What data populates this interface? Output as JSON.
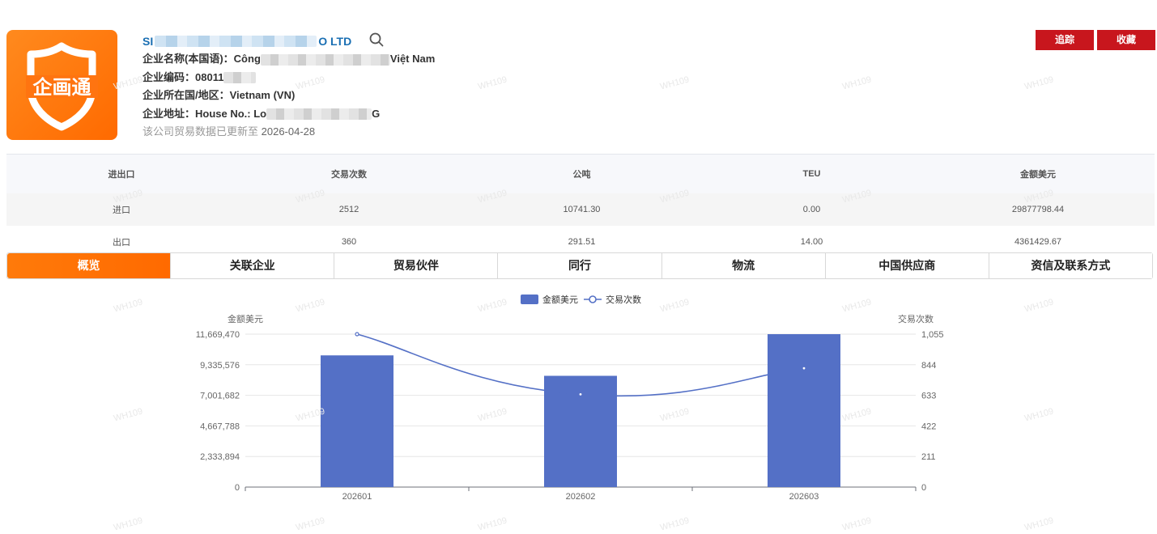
{
  "company": {
    "name_prefix": "SI",
    "name_suffix": "O LTD",
    "local_name_label": "企业名称(本国语)：",
    "local_name_prefix": "Công",
    "local_name_suffix": "Việt Nam",
    "code_label": "企业编码：",
    "code_prefix": "08011",
    "country_label": "企业所在国/地区：",
    "country": "Vietnam (VN)",
    "address_label": "企业地址：",
    "address_prefix": "House No.: Lo",
    "address_suffix": "G",
    "updated_label": "该公司贸易数据已更新至",
    "updated_date": "2026-04-28",
    "logo_text": "企画通"
  },
  "actions": {
    "track": "追踪",
    "favorite": "收藏"
  },
  "stats": {
    "headers": [
      "进出口",
      "交易次数",
      "公吨",
      "TEU",
      "金额美元"
    ],
    "rows": [
      [
        "进口",
        "2512",
        "10741.30",
        "0.00",
        "29877798.44"
      ],
      [
        "出口",
        "360",
        "291.51",
        "14.00",
        "4361429.67"
      ]
    ]
  },
  "tabs": [
    "概览",
    "关联企业",
    "贸易伙伴",
    "同行",
    "物流",
    "中国供应商",
    "资信及联系方式"
  ],
  "watermark": "WH109",
  "colors": {
    "accent": "#ff6a00",
    "brand_blue": "#1a6fb3",
    "button_red": "#c8161d",
    "bar": "#5470c6",
    "line": "#5470c6"
  },
  "chart_data": {
    "type": "bar",
    "categories": [
      "202601",
      "202602",
      "202603"
    ],
    "series": [
      {
        "name": "金额美元",
        "type": "bar",
        "axis": "left",
        "values": [
          10050000,
          8490000,
          11669470
        ]
      },
      {
        "name": "交易次数",
        "type": "line",
        "axis": "right",
        "values": [
          1055,
          640,
          820
        ]
      }
    ],
    "ylabel": "金额美元",
    "y2label": "交易次数",
    "ylim": [
      0,
      11669470
    ],
    "y2lim": [
      0,
      1055
    ],
    "yticks": [
      "0",
      "2,333,894",
      "4,667,788",
      "7,001,682",
      "9,335,576",
      "11,669,470"
    ],
    "y2ticks": [
      "0",
      "211",
      "422",
      "633",
      "844",
      "1,055"
    ],
    "legend": "top-center",
    "grid": true
  }
}
